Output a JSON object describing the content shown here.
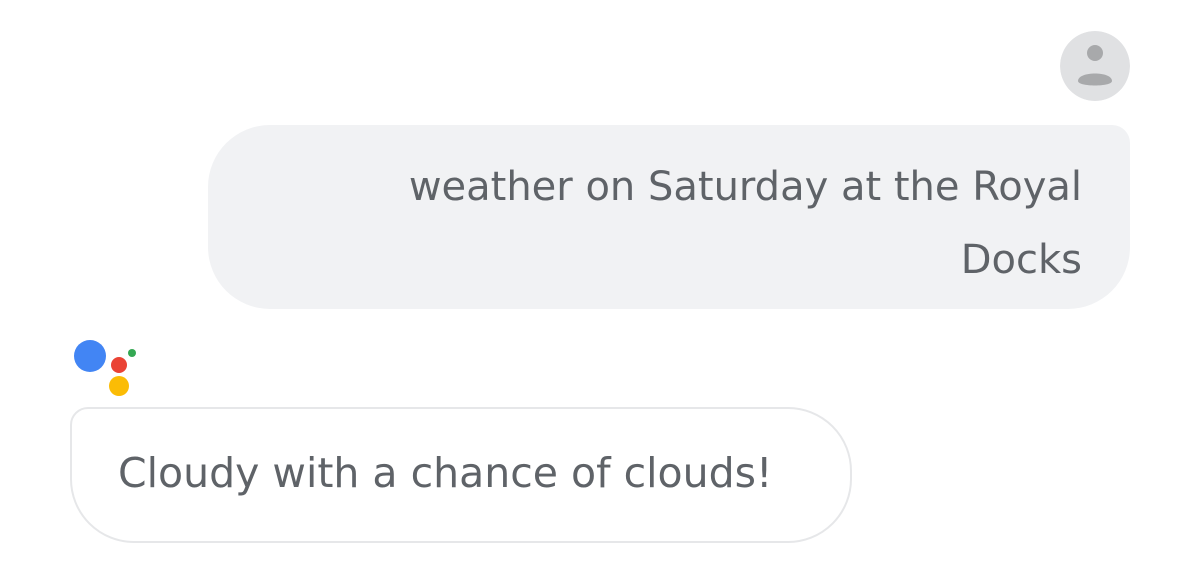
{
  "conversation": {
    "user_message": "weather on Saturday at the Royal Docks",
    "assistant_message": "Cloudy with a chance of clouds!"
  },
  "icons": {
    "user_avatar": "user-avatar-icon",
    "assistant_logo": "google-assistant-logo"
  },
  "colors": {
    "user_bubble_bg": "#f1f2f4",
    "text": "#5f6368",
    "assistant_bubble_border": "#e6e7e9",
    "assistant_blue": "#4285f4",
    "assistant_red": "#ea4335",
    "assistant_yellow": "#fbbc05",
    "assistant_green": "#34a853"
  }
}
